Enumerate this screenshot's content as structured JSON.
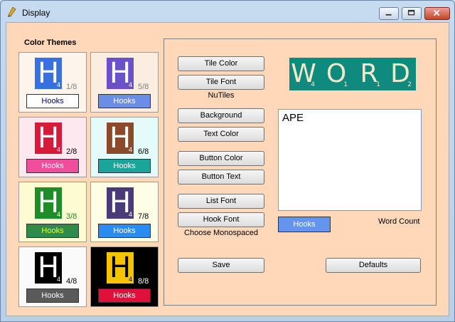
{
  "window": {
    "title": "Display"
  },
  "left": {
    "section_title": "Color Themes",
    "themes": [
      {
        "letter": "H",
        "sub": "4",
        "fraction": "1/8",
        "hooks": "Hooks",
        "panel_bg": "#fdf4ec",
        "tile_bg": "#3a6fe0",
        "tile_fg": "#ffffff",
        "frac_color": "#808080",
        "hooks_bg": "#ffffff",
        "hooks_fg": "#000080"
      },
      {
        "letter": "H",
        "sub": "4",
        "fraction": "5/8",
        "hooks": "Hooks",
        "panel_bg": "#fbeee0",
        "tile_bg": "#6a51c8",
        "tile_fg": "#ffffff",
        "frac_color": "#808080",
        "hooks_bg": "#6a8ee8",
        "hooks_fg": "#ffffff"
      },
      {
        "letter": "H",
        "sub": "4",
        "fraction": "2/8",
        "hooks": "Hooks",
        "panel_bg": "#fde8ef",
        "tile_bg": "#d81a3a",
        "tile_fg": "#ffffff",
        "frac_color": "#000000",
        "hooks_bg": "#f04e9c",
        "hooks_fg": "#ffffff"
      },
      {
        "letter": "H",
        "sub": "4",
        "fraction": "6/8",
        "hooks": "Hooks",
        "panel_bg": "#e4fbfa",
        "tile_bg": "#8b4a2a",
        "tile_fg": "#ffffff",
        "frac_color": "#000000",
        "hooks_bg": "#1aa59a",
        "hooks_fg": "#ffffff"
      },
      {
        "letter": "H",
        "sub": "4",
        "fraction": "3/8",
        "hooks": "Hooks",
        "panel_bg": "#fdfbd2",
        "tile_bg": "#1f8c2a",
        "tile_fg": "#ffffff",
        "frac_color": "#1f8c2a",
        "hooks_bg": "#2e8b4a",
        "hooks_fg": "#ffff00"
      },
      {
        "letter": "H",
        "sub": "4",
        "fraction": "7/8",
        "hooks": "Hooks",
        "panel_bg": "#fefde6",
        "tile_bg": "#4b3a7a",
        "tile_fg": "#ffffff",
        "frac_color": "#000000",
        "hooks_bg": "#2a8cf0",
        "hooks_fg": "#ffffff"
      },
      {
        "letter": "H",
        "sub": "4",
        "fraction": "4/8",
        "hooks": "Hooks",
        "panel_bg": "#fafafa",
        "tile_bg": "#000000",
        "tile_fg": "#ffffff",
        "frac_color": "#000000",
        "hooks_bg": "#5a5a5a",
        "hooks_fg": "#ffffff"
      },
      {
        "letter": "H",
        "sub": "4",
        "fraction": "8/8",
        "hooks": "Hooks",
        "panel_bg": "#000000",
        "tile_bg": "#f5c400",
        "tile_fg": "#000000",
        "frac_color": "#ffffff",
        "hooks_bg": "#e0103a",
        "hooks_fg": "#ffffff"
      }
    ]
  },
  "right": {
    "buttons": {
      "tile_color": "Tile Color",
      "tile_font": "Tile Font",
      "background": "Background",
      "text_color": "Text Color",
      "button_color": "Button Color",
      "button_text": "Button Text",
      "list_font": "List Font",
      "hook_font": "Hook Font",
      "save": "Save",
      "defaults": "Defaults"
    },
    "tile_font_name": "NuTiles",
    "hook_font_note": "Choose Monospaced",
    "word_preview": [
      {
        "letter": "W",
        "sub": "4"
      },
      {
        "letter": "O",
        "sub": "1"
      },
      {
        "letter": "R",
        "sub": "1"
      },
      {
        "letter": "D",
        "sub": "2"
      }
    ],
    "list_items": [
      "APE"
    ],
    "hooks_button": "Hooks",
    "word_count_label": "Word Count"
  },
  "colors": {
    "client_bg": "#fed8b9",
    "word_tile_bg": "#0e8a7e",
    "hooks_button_bg": "#6495ed"
  }
}
